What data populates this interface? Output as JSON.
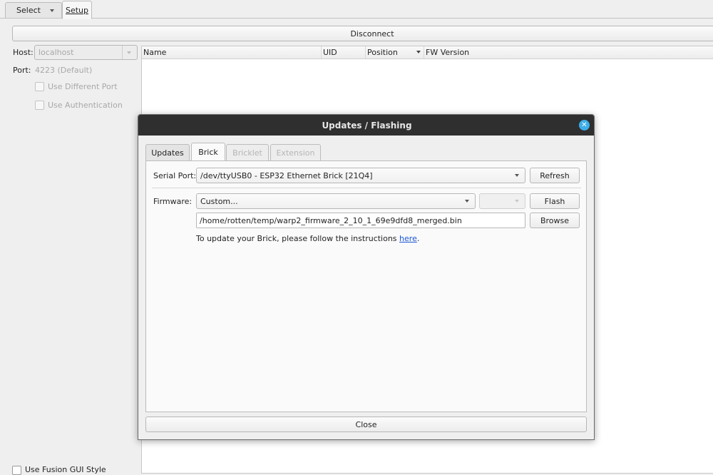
{
  "main_tabs": {
    "select": "Select",
    "setup": "Setup"
  },
  "disconnect_label": "Disconnect",
  "left_panel": {
    "host_label": "Host:",
    "host_value": "localhost",
    "port_label": "Port:",
    "port_value": "4223 (Default)",
    "use_different_port": "Use Different Port",
    "use_authentication": "Use Authentication",
    "use_fusion_gui_style": "Use Fusion GUI Style"
  },
  "table": {
    "columns": [
      "Name",
      "UID",
      "Position",
      "FW Version"
    ]
  },
  "dialog": {
    "title": "Updates / Flashing",
    "tabs": [
      "Updates",
      "Brick",
      "Bricklet",
      "Extension"
    ],
    "serial_port_label": "Serial Port:",
    "serial_port_value": "/dev/ttyUSB0 - ESP32 Ethernet Brick [21Q4]",
    "refresh_label": "Refresh",
    "firmware_label": "Firmware:",
    "firmware_value": "Custom...",
    "flash_label": "Flash",
    "firmware_path": "/home/rotten/temp/warp2_firmware_2_10_1_69e9dfd8_merged.bin",
    "browse_label": "Browse",
    "instructions_prefix": "To update your Brick, please follow the instructions ",
    "instructions_link": "here",
    "instructions_suffix": ".",
    "close_label": "Close"
  }
}
